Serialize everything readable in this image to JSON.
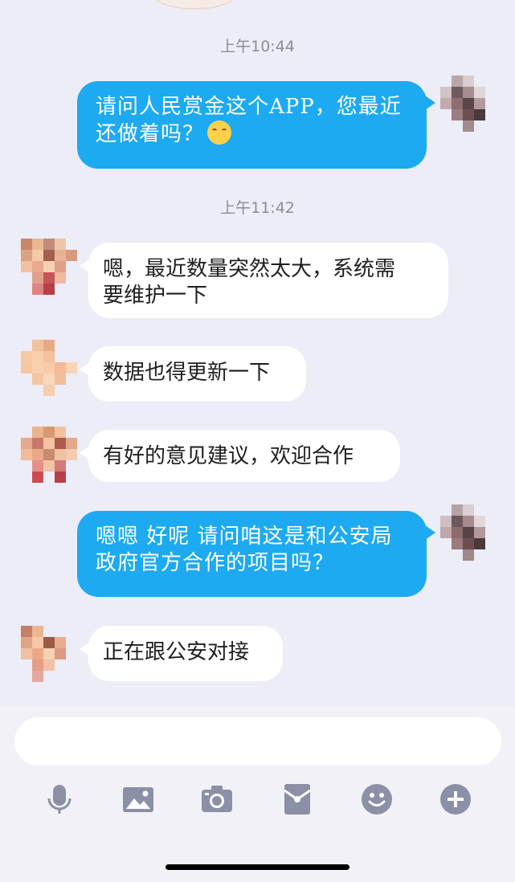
{
  "chat": {
    "messages": [
      {
        "type": "time",
        "text": "上午10:44"
      },
      {
        "type": "sent",
        "lines": [
          "请问人民赏金这个APP，您最近",
          "还做着吗？"
        ],
        "emoji": "smiling-face-emoji"
      },
      {
        "type": "time",
        "text": "上午11:42"
      },
      {
        "type": "received",
        "lines": [
          "嗯，最近数量突然太大，系统需",
          "要维护一下"
        ]
      },
      {
        "type": "received",
        "lines": [
          "数据也得更新一下"
        ]
      },
      {
        "type": "received",
        "lines": [
          "有好的意见建议，欢迎合作"
        ]
      },
      {
        "type": "sent",
        "lines": [
          "嗯嗯 好呢 请问咱这是和公安局",
          "政府官方合作的项目吗？"
        ]
      },
      {
        "type": "received",
        "lines": [
          "正在跟公安对接"
        ]
      }
    ]
  },
  "composer": {
    "input_value": "",
    "tools": [
      "microphone-icon",
      "image-icon",
      "camera-icon",
      "red-packet-icon",
      "emoji-icon",
      "plus-icon"
    ]
  },
  "colors": {
    "background": "#ecedf6",
    "sent_bubble": "#1daaf1",
    "received_bubble": "#ffffff",
    "tool_icon": "#8c90a6"
  }
}
